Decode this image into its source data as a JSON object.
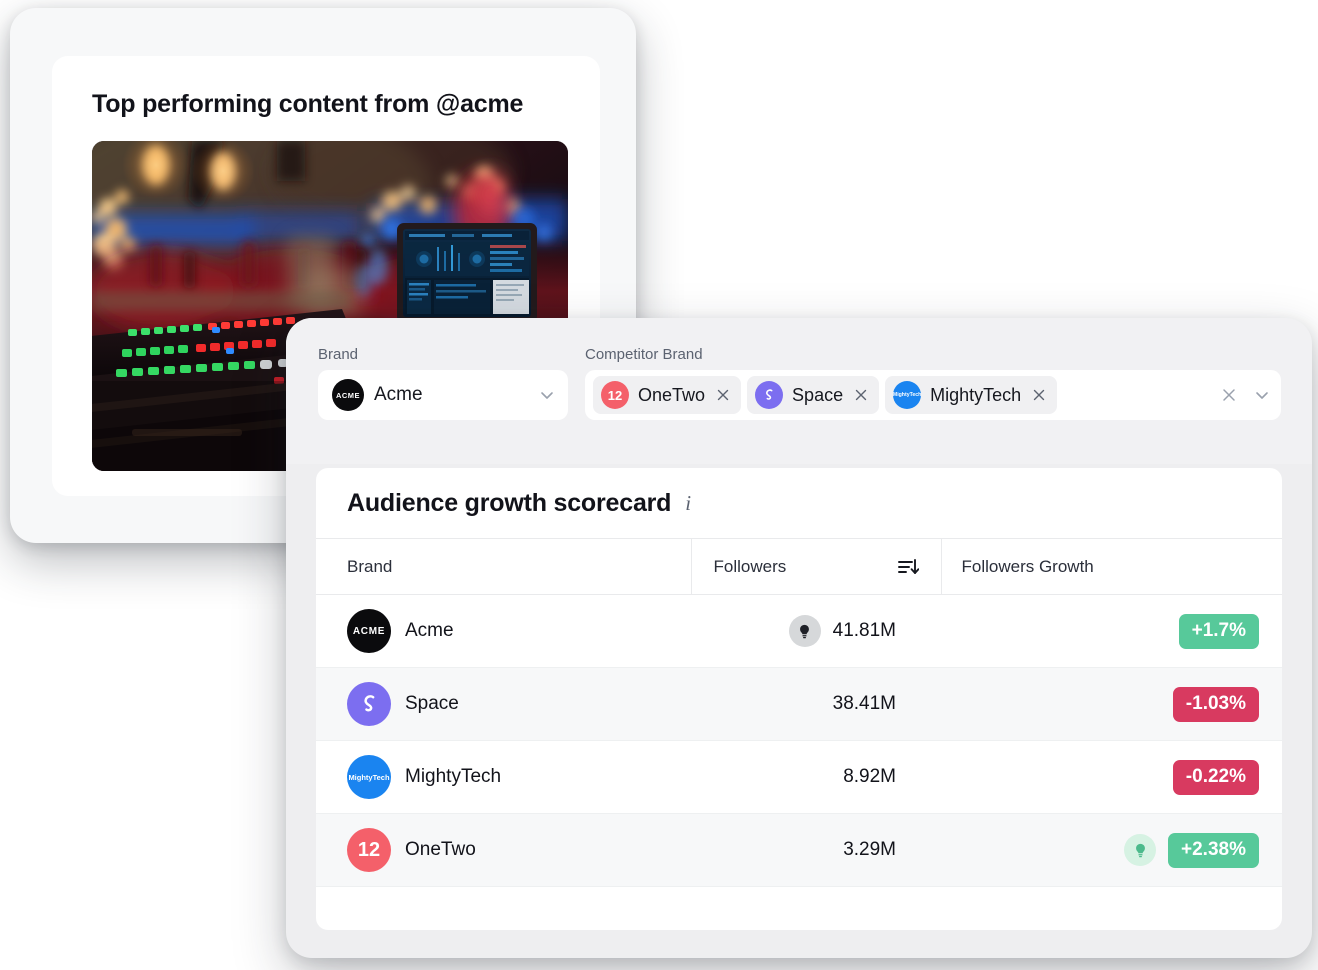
{
  "left_card": {
    "title": "Top performing content from @acme",
    "media": {
      "icon": "photo-thumbnail",
      "alt": "DJ mixing console with colorful LEDs and a laptop running audio software at a dim venue"
    }
  },
  "filters": {
    "brand": {
      "label": "Brand",
      "selected": "Acme",
      "avatar": "acme-logo",
      "chevron_icon": "chevron-down-icon"
    },
    "competitor": {
      "label": "Competitor Brand",
      "chips": [
        {
          "name": "OneTwo",
          "avatar": "onetwo-logo",
          "remove_icon": "close-icon"
        },
        {
          "name": "Space",
          "avatar": "space-logo",
          "remove_icon": "close-icon"
        },
        {
          "name": "MightyTech",
          "avatar": "mightytech-logo",
          "remove_icon": "close-icon"
        }
      ],
      "clear_icon": "close-icon",
      "chevron_icon": "chevron-down-icon"
    }
  },
  "scorecard": {
    "title": "Audience growth scorecard",
    "info_icon": "info-icon",
    "columns": {
      "brand": "Brand",
      "followers": "Followers",
      "growth": "Followers Growth"
    },
    "sort_icon": "sort-descending-icon",
    "rows": [
      {
        "brand": "Acme",
        "avatar": "acme-logo",
        "followers": "41.81M",
        "followers_insight_icon": "lightbulb-icon",
        "followers_insight_tone": "gray",
        "growth": "+1.7%",
        "growth_tone": "positive",
        "growth_insight_icon": null
      },
      {
        "brand": "Space",
        "avatar": "space-logo",
        "followers": "38.41M",
        "followers_insight_icon": null,
        "followers_insight_tone": null,
        "growth": "-1.03%",
        "growth_tone": "negative",
        "growth_insight_icon": null
      },
      {
        "brand": "MightyTech",
        "avatar": "mightytech-logo",
        "followers": "8.92M",
        "followers_insight_icon": null,
        "followers_insight_tone": null,
        "growth": "-0.22%",
        "growth_tone": "negative",
        "growth_insight_icon": null
      },
      {
        "brand": "OneTwo",
        "avatar": "onetwo-logo",
        "followers": "3.29M",
        "followers_insight_icon": null,
        "followers_insight_tone": null,
        "growth": "+2.38%",
        "growth_tone": "positive",
        "growth_insight_icon": "lightbulb-icon",
        "growth_insight_tone": "green"
      }
    ]
  },
  "brand_marks": {
    "acme_text": "ACME",
    "mightytech_text": "MightyTech",
    "onetwo_text": "12"
  },
  "colors": {
    "positive": "#57c99a",
    "negative": "#d83a60",
    "acme": "#0b0b0d",
    "space": "#7c6ef0",
    "mightytech": "#1a84f0",
    "onetwo": "#f4606a"
  }
}
